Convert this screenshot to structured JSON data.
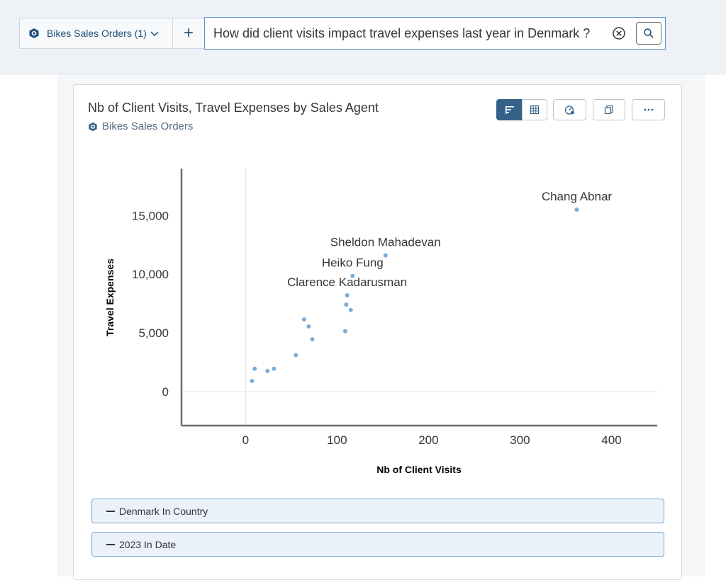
{
  "header": {
    "model_selector": {
      "label": "Bikes Sales Orders (1)",
      "icon": "cube-icon"
    },
    "add_label": "+",
    "search": {
      "value": "How did client visits impact travel expenses last year in Denmark ?"
    }
  },
  "card": {
    "title": "Nb of Client Visits, Travel Expenses by Sales Agent",
    "subtitle": "Bikes Sales Orders"
  },
  "filters": [
    {
      "label": "Denmark In Country"
    },
    {
      "label": "2023 In Date"
    }
  ],
  "colors": {
    "accent": "#346187",
    "point": "#7aaedb",
    "filter_bg": "#eaf1f8"
  },
  "chart_data": {
    "type": "scatter",
    "xlabel": "Nb of Client Visits",
    "ylabel": "Travel Expenses",
    "xlim": [
      -70,
      450
    ],
    "ylim": [
      -2900,
      19000
    ],
    "xticks": [
      0,
      100,
      200,
      300,
      400
    ],
    "xtick_labels": [
      "0",
      "100",
      "200",
      "300",
      "400"
    ],
    "yticks": [
      0,
      5000,
      10000,
      15000
    ],
    "ytick_labels": [
      "0",
      "5,000",
      "10,000",
      "15,000"
    ],
    "grid": false,
    "points": [
      {
        "x": 7,
        "y": 900,
        "label": ""
      },
      {
        "x": 10,
        "y": 1950,
        "label": ""
      },
      {
        "x": 24,
        "y": 1750,
        "label": ""
      },
      {
        "x": 31,
        "y": 1950,
        "label": ""
      },
      {
        "x": 55,
        "y": 3100,
        "label": ""
      },
      {
        "x": 64,
        "y": 6150,
        "label": ""
      },
      {
        "x": 69,
        "y": 5550,
        "label": ""
      },
      {
        "x": 73,
        "y": 4450,
        "label": ""
      },
      {
        "x": 109,
        "y": 5150,
        "label": ""
      },
      {
        "x": 110,
        "y": 7400,
        "label": ""
      },
      {
        "x": 111,
        "y": 8200,
        "label": "Clarence Kadarusman"
      },
      {
        "x": 115,
        "y": 6950,
        "label": ""
      },
      {
        "x": 117,
        "y": 9850,
        "label": "Heiko Fung"
      },
      {
        "x": 153,
        "y": 11600,
        "label": "Sheldon Mahadevan"
      },
      {
        "x": 362,
        "y": 15500,
        "label": "Chang Abnar"
      }
    ]
  }
}
